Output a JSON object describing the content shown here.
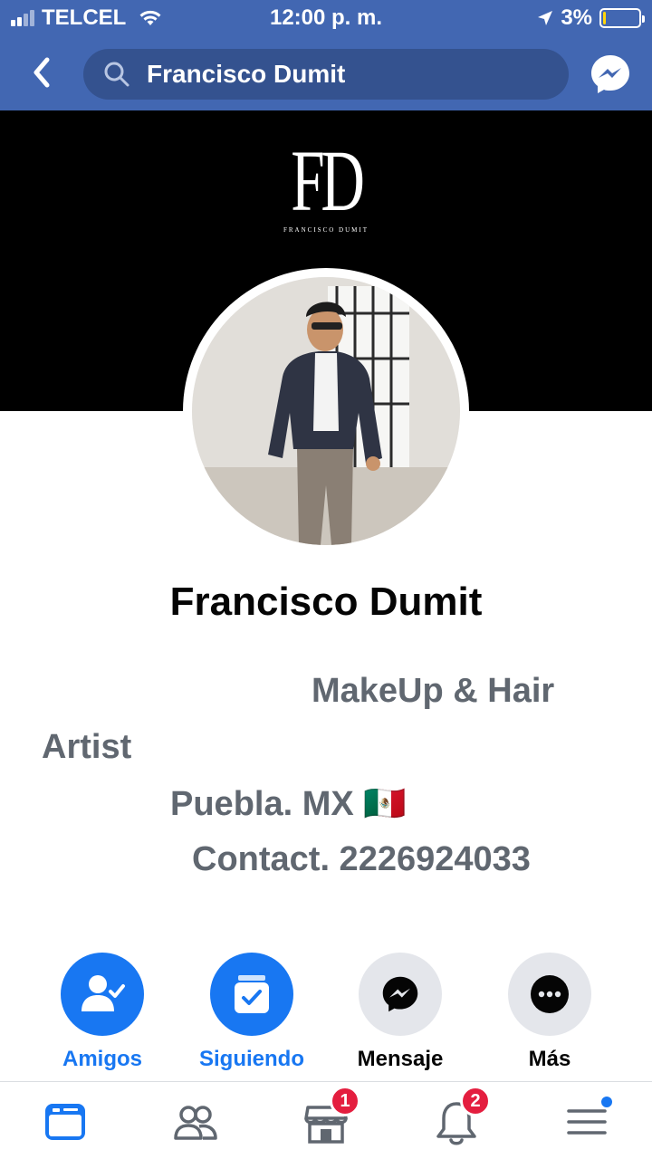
{
  "status_bar": {
    "carrier": "TELCEL",
    "time": "12:00 p. m.",
    "battery_text": "3%",
    "battery_level": 0.03,
    "battery_color": "#ffd60a"
  },
  "nav": {
    "back_icon": "chevron-left-icon",
    "search_text": "Francisco Dumit",
    "messenger_icon": "messenger-icon",
    "bar_color": "#4267b2"
  },
  "cover": {
    "logo_monogram": "FD",
    "logo_subtitle": "FRANCISCO DUMIT"
  },
  "profile": {
    "name": "Francisco Dumit",
    "bio_lines": [
      "MakeUp & Hair",
      "Artist",
      "Puebla. MX 🇲🇽",
      "Contact. 2226924033"
    ]
  },
  "actions": [
    {
      "label": "Amigos",
      "icon": "friends-check-icon",
      "style": "blue"
    },
    {
      "label": "Siguiendo",
      "icon": "following-check-icon",
      "style": "blue"
    },
    {
      "label": "Mensaje",
      "icon": "messenger-icon",
      "style": "gray"
    },
    {
      "label": "Más",
      "icon": "more-dots-icon",
      "style": "gray"
    }
  ],
  "tabbar": {
    "items": [
      {
        "name": "news-feed-tab",
        "icon": "news-feed-icon",
        "active": true
      },
      {
        "name": "friends-tab",
        "icon": "friends-icon"
      },
      {
        "name": "marketplace-tab",
        "icon": "marketplace-icon",
        "badge": "1"
      },
      {
        "name": "notifications-tab",
        "icon": "bell-icon",
        "badge": "2"
      },
      {
        "name": "menu-tab",
        "icon": "menu-icon",
        "dot": true
      }
    ]
  },
  "colors": {
    "accent": "#1877f2",
    "badge": "#e41e3f",
    "bio_text": "#606770"
  }
}
